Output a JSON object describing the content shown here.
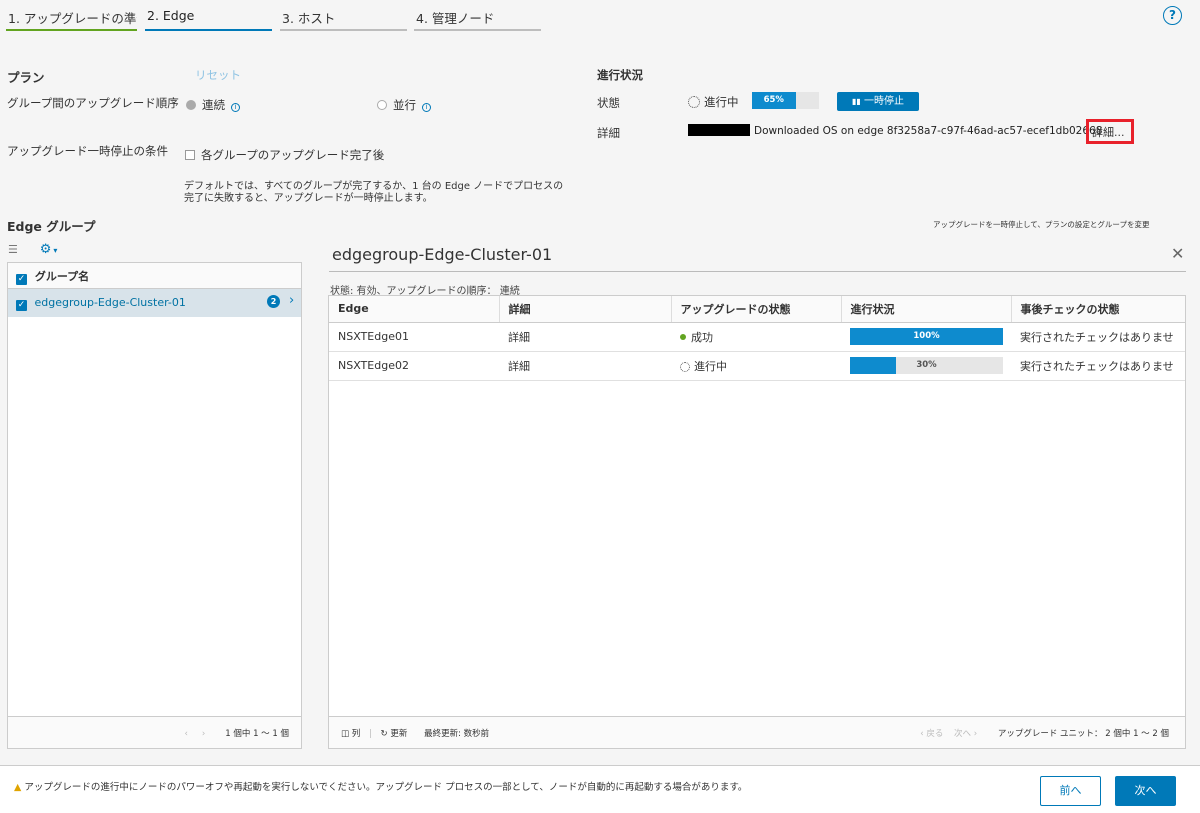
{
  "tabs": [
    {
      "label": "1. アップグレードの準備"
    },
    {
      "label": "2. Edge"
    },
    {
      "label": "3. ホスト"
    },
    {
      "label": "4. 管理ノード"
    }
  ],
  "help_icon": "?",
  "plan": {
    "title": "プラン",
    "reset": "リセット",
    "order_label": "グループ間のアップグレード順序",
    "serial": "連続",
    "parallel": "並行",
    "pause_label": "アップグレード一時停止の条件",
    "pause_option": "各グループのアップグレード完了後",
    "note_line1": "デフォルトでは、すべてのグループが完了するか、1 台の Edge ノードでプロセスの",
    "note_line2": "完了に失敗すると、アップグレードが一時停止します。"
  },
  "progress": {
    "title": "進行状況",
    "state_label": "状態",
    "state_value": "進行中",
    "percent": 65,
    "percent_text": "65%",
    "pause_button": "一時停止",
    "detail_label": "詳細",
    "detail_text": "Downloaded OS on edge 8f3258a7-c97f-46ad-ac57-ecef1db02668",
    "detail_link": "詳細..."
  },
  "edge_groups": {
    "title": "Edge グループ",
    "hint": "アップグレードを一時停止して、プランの設定とグループを変更",
    "column_header": "グループ名",
    "items": [
      {
        "name": "edgegroup-Edge-Cluster-01",
        "count": "2"
      }
    ],
    "pager_text": "1 個中 1 ～ 1 個"
  },
  "detail": {
    "title": "edgegroup-Edge-Cluster-01",
    "status_line": "状態: 有効、アップグレードの順序： 連続",
    "columns": [
      "Edge",
      "詳細",
      "アップグレードの状態",
      "進行状況",
      "事後チェックの状態"
    ],
    "rows": [
      {
        "edge": "NSXTEdge01",
        "detail": "詳細",
        "status": "成功",
        "progress": 100,
        "progress_text": "100%",
        "check": "実行されたチェックはありませ"
      },
      {
        "edge": "NSXTEdge02",
        "detail": "詳細",
        "status": "進行中",
        "progress": 30,
        "progress_text": "30%",
        "check": "実行されたチェックはありませ"
      }
    ],
    "footer_columns": "列",
    "footer_refresh": "更新",
    "footer_last": "最終更新: 数秒前",
    "footer_back": "戻る",
    "footer_next": "次へ",
    "footer_units": "アップグレード ユニット： 2 個中 1 ～ 2 個"
  },
  "footer": {
    "warning": "アップグレードの進行中にノードのパワーオフや再起動を実行しないでください。アップグレード プロセスの一部として、ノードが自動的に再起動する場合があります。",
    "prev": "前へ",
    "next": "次へ"
  },
  "colors": {
    "accent": "#0079b8",
    "success": "#62a420",
    "progress": "#0e8bce",
    "highlight": "#e8212b"
  }
}
